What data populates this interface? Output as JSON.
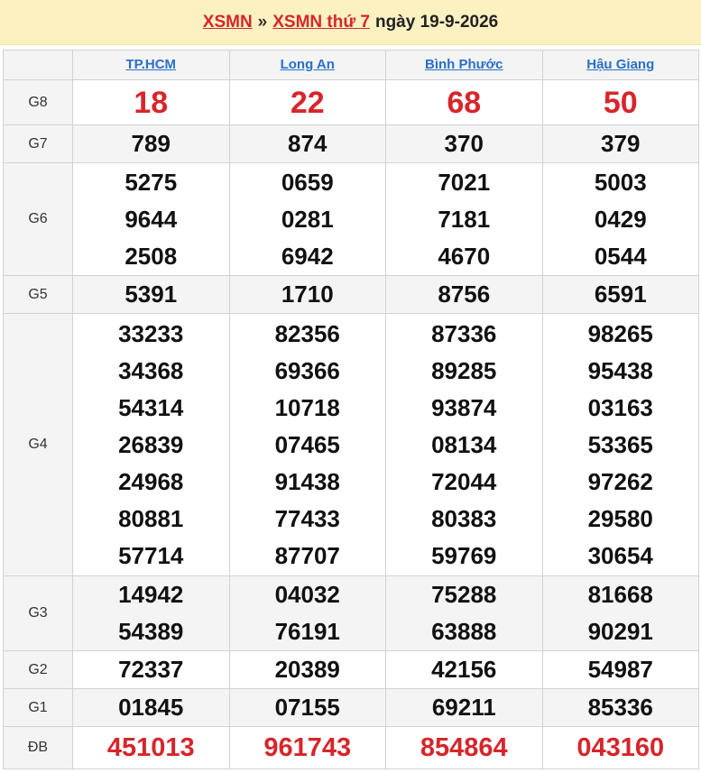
{
  "header": {
    "link1": "XSMN",
    "separator": "»",
    "link2": "XSMN thứ 7",
    "date_text": "ngày 19-9-2026"
  },
  "provinces": [
    "TP.HCM",
    "Long An",
    "Bình Phước",
    "Hậu Giang"
  ],
  "prizes": [
    {
      "label": "G8",
      "key": "g8",
      "style": "big-red",
      "values": [
        [
          "18"
        ],
        [
          "22"
        ],
        [
          "68"
        ],
        [
          "50"
        ]
      ]
    },
    {
      "label": "G7",
      "key": "g7",
      "style": "",
      "values": [
        [
          "789"
        ],
        [
          "874"
        ],
        [
          "370"
        ],
        [
          "379"
        ]
      ]
    },
    {
      "label": "G6",
      "key": "g6",
      "style": "",
      "values": [
        [
          "5275",
          "9644",
          "2508"
        ],
        [
          "0659",
          "0281",
          "6942"
        ],
        [
          "7021",
          "7181",
          "4670"
        ],
        [
          "5003",
          "0429",
          "0544"
        ]
      ]
    },
    {
      "label": "G5",
      "key": "g5",
      "style": "",
      "values": [
        [
          "5391"
        ],
        [
          "1710"
        ],
        [
          "8756"
        ],
        [
          "6591"
        ]
      ]
    },
    {
      "label": "G4",
      "key": "g4",
      "style": "",
      "values": [
        [
          "33233",
          "34368",
          "54314",
          "26839",
          "24968",
          "80881",
          "57714"
        ],
        [
          "82356",
          "69366",
          "10718",
          "07465",
          "91438",
          "77433",
          "87707"
        ],
        [
          "87336",
          "89285",
          "93874",
          "08134",
          "72044",
          "80383",
          "59769"
        ],
        [
          "98265",
          "95438",
          "03163",
          "53365",
          "97262",
          "29580",
          "30654"
        ]
      ]
    },
    {
      "label": "G3",
      "key": "g3",
      "style": "",
      "values": [
        [
          "14942",
          "54389"
        ],
        [
          "04032",
          "76191"
        ],
        [
          "75288",
          "63888"
        ],
        [
          "81668",
          "90291"
        ]
      ]
    },
    {
      "label": "G2",
      "key": "g2",
      "style": "",
      "values": [
        [
          "72337"
        ],
        [
          "20389"
        ],
        [
          "42156"
        ],
        [
          "54987"
        ]
      ]
    },
    {
      "label": "G1",
      "key": "g1",
      "style": "",
      "values": [
        [
          "01845"
        ],
        [
          "07155"
        ],
        [
          "69211"
        ],
        [
          "85336"
        ]
      ]
    },
    {
      "label": "ĐB",
      "key": "db",
      "style": "db-red",
      "values": [
        [
          "451013"
        ],
        [
          "961743"
        ],
        [
          "854864"
        ],
        [
          "043160"
        ]
      ]
    }
  ]
}
